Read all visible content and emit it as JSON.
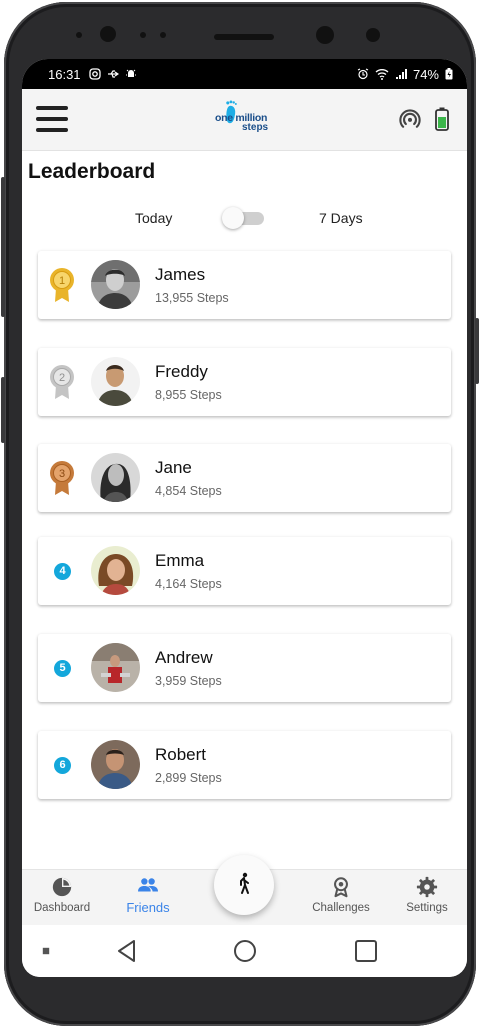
{
  "status_bar": {
    "time": "16:31",
    "battery_percent": "74%"
  },
  "header": {
    "logo_line1": "one million",
    "logo_line2": "steps"
  },
  "page": {
    "title": "Leaderboard"
  },
  "period_toggle": {
    "left_label": "Today",
    "right_label": "7 Days",
    "is_on": false
  },
  "leaderboard": [
    {
      "rank": "1",
      "badge": "gold-medal-icon",
      "name": "James",
      "steps": "13,955 Steps"
    },
    {
      "rank": "2",
      "badge": "silver-medal-icon",
      "name": "Freddy",
      "steps": "8,955 Steps"
    },
    {
      "rank": "3",
      "badge": "bronze-medal-icon",
      "name": "Jane",
      "steps": "4,854 Steps"
    },
    {
      "rank": "4",
      "badge": "rank-circle",
      "name": "Emma",
      "steps": "4,164 Steps"
    },
    {
      "rank": "5",
      "badge": "rank-circle",
      "name": "Andrew",
      "steps": "3,959 Steps"
    },
    {
      "rank": "6",
      "badge": "rank-circle",
      "name": "Robert",
      "steps": "2,899 Steps"
    }
  ],
  "bottom_nav": {
    "items": [
      {
        "label": "Dashboard",
        "icon": "pie-chart-icon"
      },
      {
        "label": "Friends",
        "icon": "people-icon",
        "active": true
      },
      {
        "label": "Challenges",
        "icon": "award-icon"
      },
      {
        "label": "Settings",
        "icon": "gear-icon"
      }
    ],
    "fab_icon": "walking-person-icon"
  },
  "colors": {
    "accent": "#3b84e8",
    "rank_circle": "#13a7db",
    "gold": "#e9b42a",
    "silver": "#c4c4c4",
    "bronze": "#c57a3a",
    "battery": "#3bb54a"
  }
}
